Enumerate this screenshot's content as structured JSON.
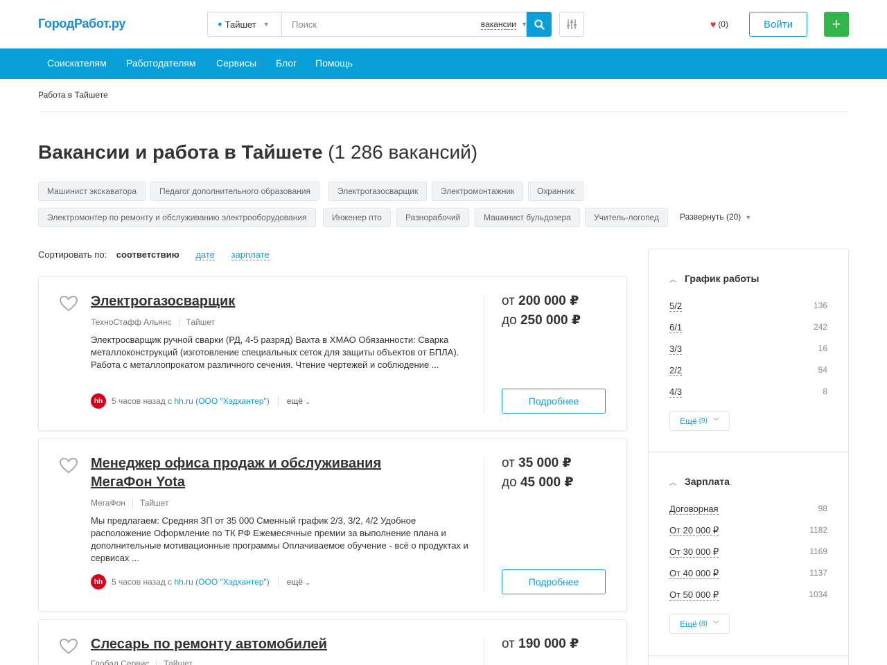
{
  "header": {
    "logo": "ГородРабот.ру",
    "city": "Тайшет",
    "search_placeholder": "Поиск",
    "search_scope": "вакансии",
    "favorites_count": "(0)",
    "login_label": "Войти",
    "add_label": "+"
  },
  "nav": {
    "items": [
      "Соискателям",
      "Работодателям",
      "Сервисы",
      "Блог",
      "Помощь"
    ]
  },
  "breadcrumb": "Работа в Тайшете",
  "page": {
    "title": "Вакансии и работа в Тайшете",
    "count": "(1 286 вакансий)"
  },
  "tags": [
    "Машинист экскаватора",
    "Педагог дополнительного образования",
    "Электрогазосварщик",
    "Электромонтажник",
    "Охранник",
    "Электромонтер по ремонту и обслуживанию электрооборудования",
    "Инженер пто",
    "Разнорабочий",
    "Машинист бульдозера",
    "Учитель-логопед"
  ],
  "expand_label": "Развернуть (20)",
  "sort": {
    "label": "Сортировать по:",
    "current": "соответствию",
    "options": [
      "дате",
      "зарплате"
    ]
  },
  "vacancies": [
    {
      "title": "Электрогазосварщик",
      "company": "ТехноСтафф Альянс",
      "city": "Тайшет",
      "description": "Электросварщик ручной сварки (РД, 4-5 разряд) Вахта в ХМАО Обязанности: Сварка металлоконструкций (изготовление специальных сеток для защиты объектов от БПЛА). Работа с металлопрокатом различного сечения. Чтение чертежей и соблюдение ...",
      "source_time": "5 часов назад с",
      "source_link": "hh.ru (ООО \"Хэдхантер\")",
      "more": "ещё",
      "salary_from_prefix": "от",
      "salary_from": "200 000",
      "salary_to_prefix": "до",
      "salary_to": "250 000",
      "currency": "₽",
      "details_label": "Подробнее"
    },
    {
      "title": "Менеджер офиса продаж и обслуживания МегаФон Yota",
      "company": "МегаФон",
      "city": "Тайшет",
      "description": "Мы предлагаем: Средняя ЗП от 35 000 Сменный график 2/3, 3/2, 4/2 Удобное расположение Оформление по ТК РФ Ежемесячные премии за выполнение плана и дополнительные мотивационные программы Оплачиваемое обучение - всё о продуктах и сервисах ...",
      "source_time": "5 часов назад с",
      "source_link": "hh.ru (ООО \"Хэдхантер\")",
      "more": "ещё",
      "salary_from_prefix": "от",
      "salary_from": "35 000",
      "salary_to_prefix": "до",
      "salary_to": "45 000",
      "currency": "₽",
      "details_label": "Подробнее"
    },
    {
      "title": "Слесарь по ремонту автомобилей",
      "company": "Глобал Сервис",
      "city": "Тайшет",
      "salary_from_prefix": "от",
      "salary_from": "190 000",
      "currency": "₽"
    }
  ],
  "sidebar": {
    "schedule": {
      "title": "График работы",
      "items": [
        {
          "label": "5/2",
          "count": "136"
        },
        {
          "label": "6/1",
          "count": "242"
        },
        {
          "label": "3/3",
          "count": "16"
        },
        {
          "label": "2/2",
          "count": "54"
        },
        {
          "label": "4/3",
          "count": "8"
        }
      ],
      "more_label": "Ещё",
      "more_count": "(9)"
    },
    "salary": {
      "title": "Зарплата",
      "items": [
        {
          "label": "Договорная",
          "count": "98"
        },
        {
          "label": "От 20 000 ₽",
          "count": "1182"
        },
        {
          "label": "От 30 000 ₽",
          "count": "1169"
        },
        {
          "label": "От 40 000 ₽",
          "count": "1137"
        },
        {
          "label": "От 50 000 ₽",
          "count": "1034"
        }
      ],
      "more_label": "Ещё",
      "more_count": "(8)"
    }
  },
  "colors": {
    "accent": "#0a9fd8",
    "brand": "#1e8bd1",
    "add": "#2fb54a",
    "heart": "#e0312b",
    "hh": "#d6001c"
  }
}
